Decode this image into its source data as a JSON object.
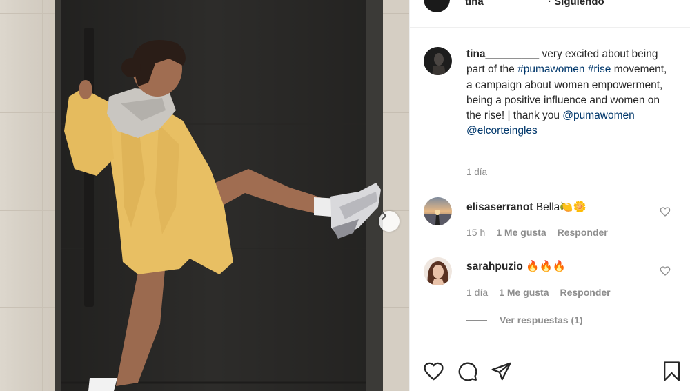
{
  "post": {
    "header_username": "tina_________",
    "header_follow": "· Siguiendo",
    "caption": {
      "username": "tina_________",
      "text_parts": [
        {
          "text": " very excited about being part of the ",
          "link": false
        },
        {
          "text": "#pumawomen",
          "link": true
        },
        {
          "text": " ",
          "link": false
        },
        {
          "text": "#rise",
          "link": true
        },
        {
          "text": " movement, a campaign about women empowerment, being a positive influence and women on the rise! | thank you ",
          "link": false
        },
        {
          "text": "@pumawomen",
          "link": true
        },
        {
          "text": " ",
          "link": false
        },
        {
          "text": "@elcorteingles",
          "link": true
        }
      ],
      "time": "1 día"
    },
    "comments": [
      {
        "username": "elisaserranot",
        "text": "Bella🍋🌼",
        "time": "15 h",
        "likes": "1 Me gusta",
        "reply_label": "Responder"
      },
      {
        "username": "sarahpuzio",
        "text": "🔥🔥🔥",
        "time": "1 día",
        "likes": "1 Me gusta",
        "reply_label": "Responder"
      }
    ],
    "view_replies": "Ver respuestas (1)"
  },
  "icons": {
    "like": "heart-icon",
    "comment": "comment-icon",
    "share": "share-icon",
    "save": "bookmark-icon",
    "next": "chevron-right-icon"
  },
  "colors": {
    "link": "#00376b",
    "muted": "#8e8e8e",
    "text": "#262626"
  }
}
